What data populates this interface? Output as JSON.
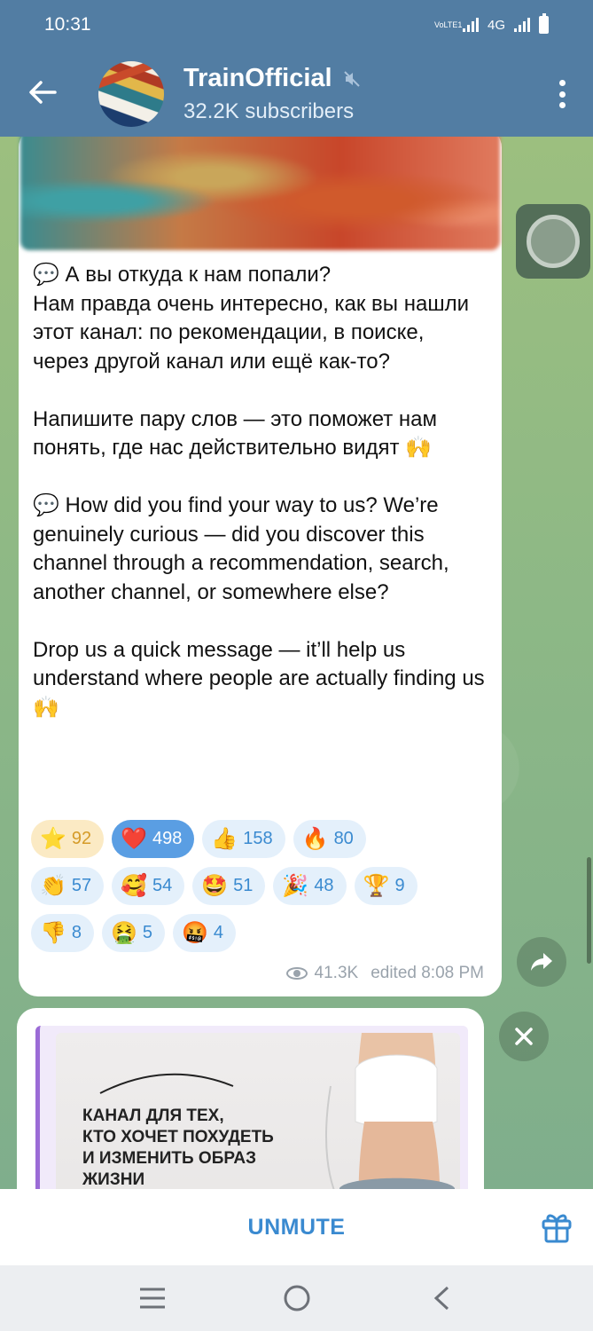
{
  "status_bar": {
    "time": "10:31",
    "network_label": "4G",
    "volte_label": "VoLTE1"
  },
  "header": {
    "channel_name": "TrainOfficial",
    "subscribers": "32.2K subscribers",
    "muted": true,
    "icons": [
      "back-arrow-icon",
      "muted-icon",
      "more-vert-icon"
    ]
  },
  "message": {
    "text": "💬 А вы откуда к нам попали?\nНам правда очень интересно, как вы нашли этот канал: по рекомендации, в поиске, через другой канал или ещё как-то?\n\nНапишите пару слов — это поможет нам понять, где нас действительно видят 🙌\n\n💬 How did you find your way to us? We’re genuinely curious — did you discover this channel through a recommendation, search, another channel, or somewhere else?\n\nDrop us a quick message — it’ll help us understand where people are actually finding us 🙌",
    "views": "41.3K",
    "edited": "edited 8:08 PM",
    "reactions": [
      [
        {
          "emoji": "⭐",
          "count": "92",
          "style": "gold"
        },
        {
          "emoji": "❤️",
          "count": "498",
          "style": "active"
        },
        {
          "emoji": "👍",
          "count": "158",
          "style": "normal"
        },
        {
          "emoji": "🔥",
          "count": "80",
          "style": "normal"
        }
      ],
      [
        {
          "emoji": "👏",
          "count": "57",
          "style": "normal"
        },
        {
          "emoji": "🥰",
          "count": "54",
          "style": "normal"
        },
        {
          "emoji": "🤩",
          "count": "51",
          "style": "normal"
        },
        {
          "emoji": "🎉",
          "count": "48",
          "style": "normal"
        },
        {
          "emoji": "🏆",
          "count": "9",
          "style": "normal"
        }
      ],
      [
        {
          "emoji": "👎",
          "count": "8",
          "style": "normal"
        },
        {
          "emoji": "🤮",
          "count": "5",
          "style": "normal"
        },
        {
          "emoji": "🤬",
          "count": "4",
          "style": "normal"
        }
      ]
    ]
  },
  "next_message": {
    "ad_text": "КАНАЛ ДЛЯ ТЕХ,\nКТО ХОЧЕТ ПОХУДЕТЬ\nИ ИЗМЕНИТЬ ОБРАЗ\nЖИЗНИ"
  },
  "bottom_bar": {
    "unmute_label": "UNMUTE"
  },
  "colors": {
    "header_bg": "#527da3",
    "accent": "#3a8ad0",
    "chat_bg": "#8fb37c"
  }
}
